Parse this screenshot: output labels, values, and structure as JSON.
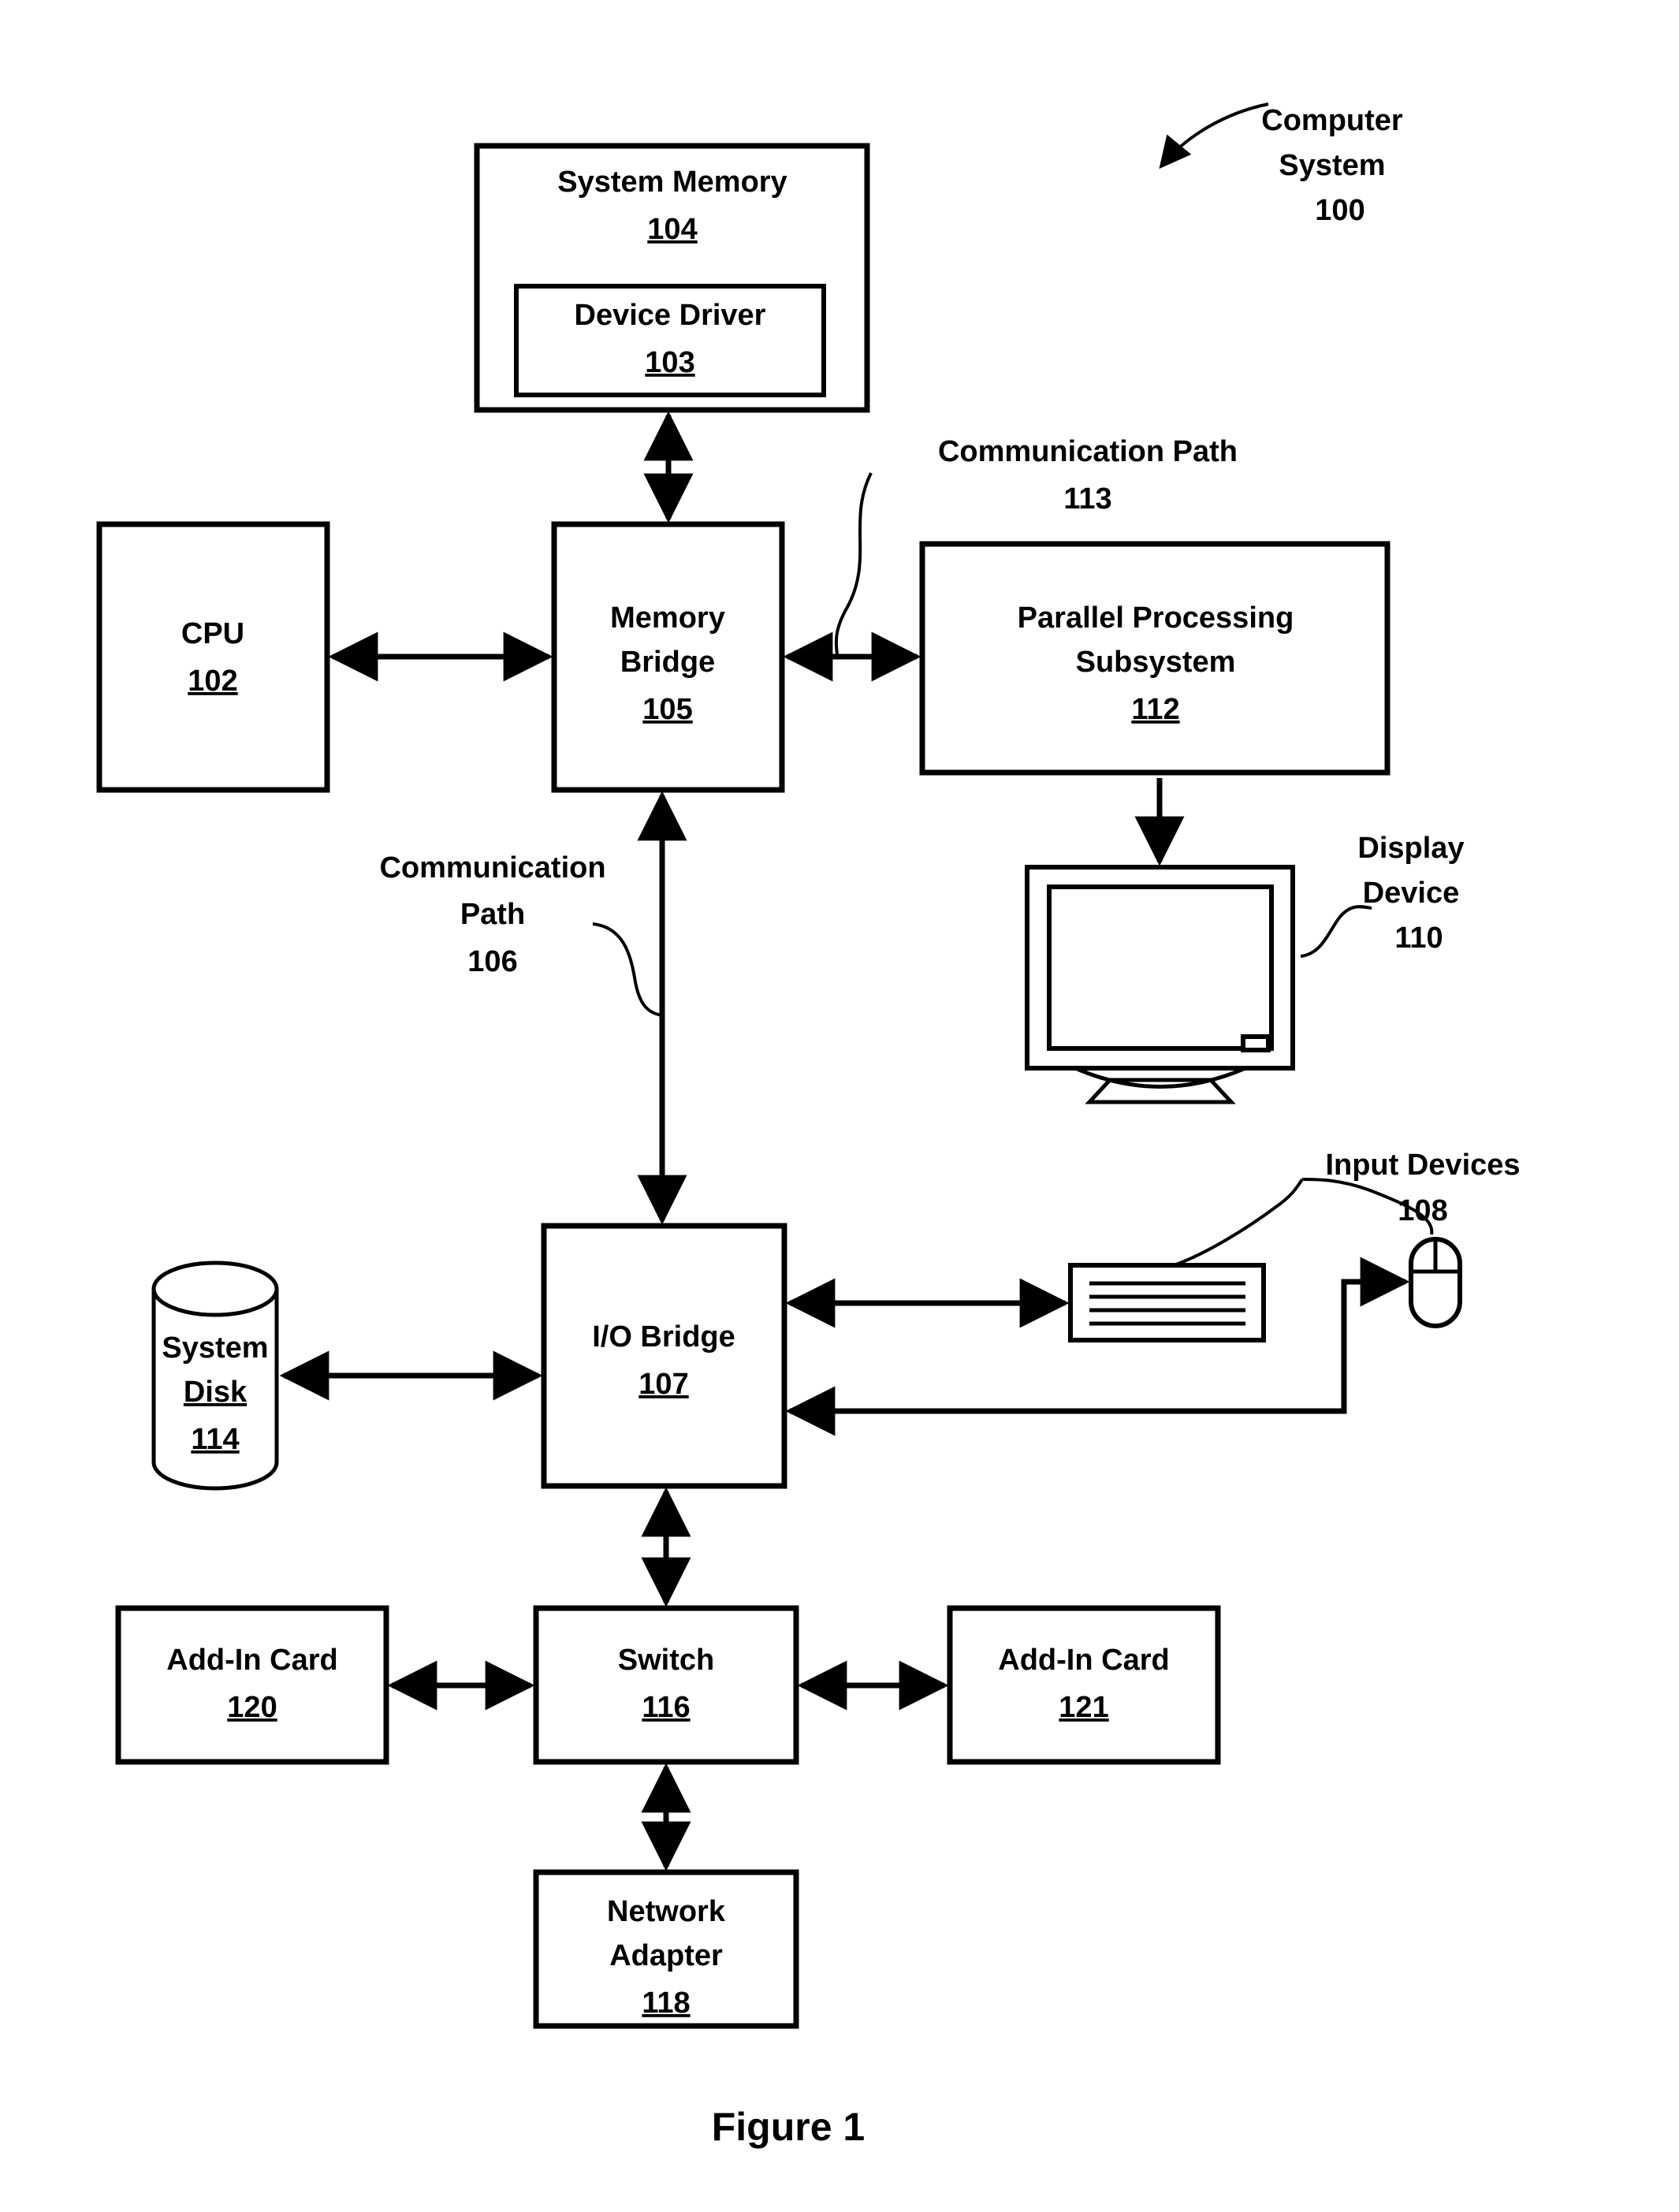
{
  "figure": {
    "caption": "Figure 1",
    "title_callout": {
      "line1": "Computer",
      "line2": "System",
      "ref": "100"
    }
  },
  "blocks": {
    "system_memory": {
      "label": "System Memory",
      "ref": "104"
    },
    "device_driver": {
      "label": "Device Driver",
      "ref": "103"
    },
    "cpu": {
      "label": "CPU",
      "ref": "102"
    },
    "memory_bridge": {
      "label_line1": "Memory",
      "label_line2": "Bridge",
      "ref": "105"
    },
    "parallel_processing_subsystem": {
      "label_line1": "Parallel Processing",
      "label_line2": "Subsystem",
      "ref": "112"
    },
    "io_bridge": {
      "label": "I/O Bridge",
      "ref": "107"
    },
    "system_disk": {
      "label_line1": "System",
      "label_line2": "Disk",
      "ref": "114"
    },
    "switch": {
      "label": "Switch",
      "ref": "116"
    },
    "add_in_card_left": {
      "label": "Add-In Card",
      "ref": "120"
    },
    "add_in_card_right": {
      "label": "Add-In Card",
      "ref": "121"
    },
    "network_adapter": {
      "label_line1": "Network",
      "label_line2": "Adapter",
      "ref": "118"
    }
  },
  "callouts": {
    "communication_path_113": {
      "line1": "Communication Path",
      "ref": "113"
    },
    "communication_path_106": {
      "line1": "Communication",
      "line2": "Path",
      "ref": "106"
    },
    "display_device": {
      "line1": "Display",
      "line2": "Device",
      "ref": "110"
    },
    "input_devices": {
      "line1": "Input Devices",
      "ref": "108"
    }
  },
  "icons": {
    "display": "monitor-icon",
    "keyboard": "keyboard-icon",
    "mouse": "mouse-icon",
    "disk": "cylinder-disk-icon"
  },
  "colors": {
    "ink": "#000000",
    "paper": "#ffffff"
  }
}
